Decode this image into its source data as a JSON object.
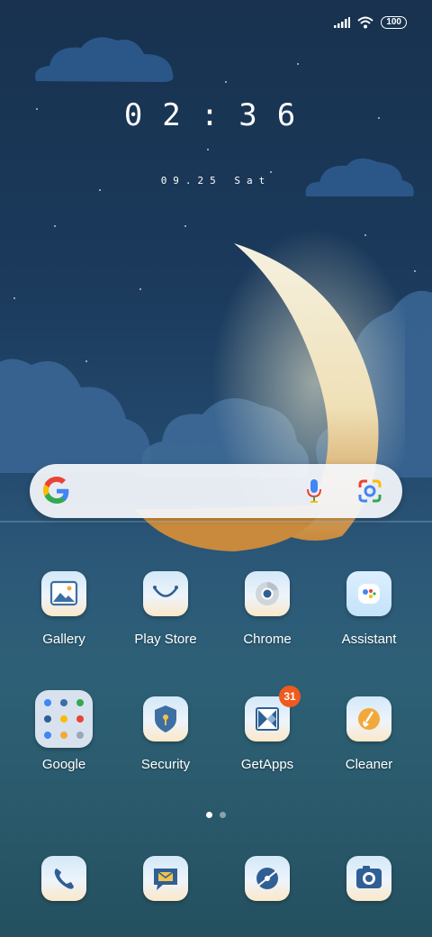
{
  "status_bar": {
    "battery": "100"
  },
  "lock": {
    "time": "02:36",
    "date": "09.25 Sat"
  },
  "search": {
    "colors": [
      "#4285f4",
      "#ea4335",
      "#fbbc05",
      "#34a853"
    ]
  },
  "apps_row1": [
    {
      "label": "Gallery",
      "icon": "gallery-icon"
    },
    {
      "label": "Play Store",
      "icon": "play-store-icon"
    },
    {
      "label": "Chrome",
      "icon": "chrome-icon"
    },
    {
      "label": "Assistant",
      "icon": "assistant-icon"
    }
  ],
  "apps_row2": [
    {
      "label": "Google",
      "icon": "google-folder-icon"
    },
    {
      "label": "Security",
      "icon": "security-icon"
    },
    {
      "label": "GetApps",
      "icon": "getapps-icon",
      "badge": "31"
    },
    {
      "label": "Cleaner",
      "icon": "cleaner-icon"
    }
  ],
  "pager": {
    "pages": 2,
    "current": 1
  },
  "dock": [
    {
      "icon": "phone-icon"
    },
    {
      "icon": "messages-icon"
    },
    {
      "icon": "browser-icon"
    },
    {
      "icon": "camera-icon"
    }
  ]
}
